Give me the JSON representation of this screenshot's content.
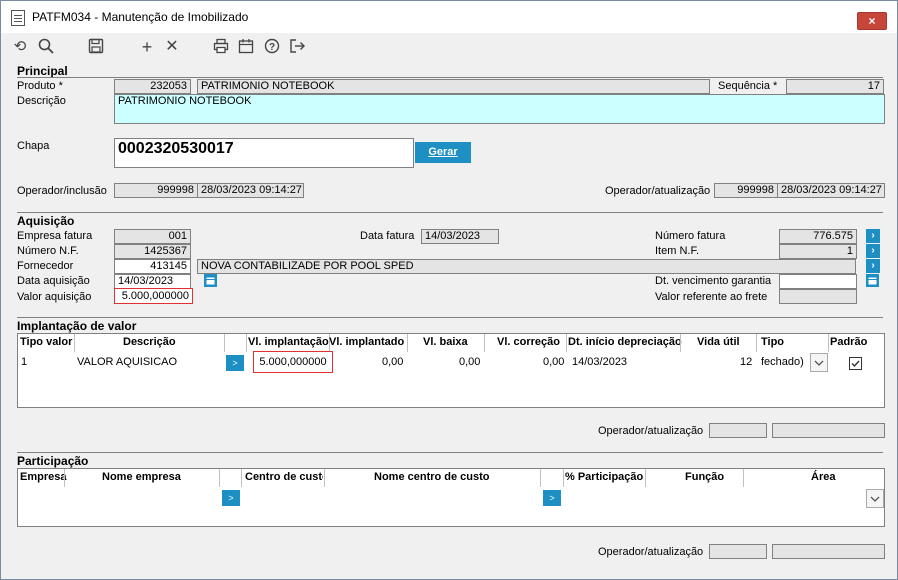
{
  "window": {
    "title": "PATFM034 - Manutenção de Imobilizado",
    "close_label": "×"
  },
  "toolbar": {
    "icons": [
      "undo-icon",
      "search-icon",
      "save-icon",
      "add-icon",
      "delete-icon",
      "print-icon",
      "calendar-icon",
      "help-icon",
      "exit-icon"
    ]
  },
  "principal": {
    "title": "Principal",
    "produto_label": "Produto *",
    "produto_code": "232053",
    "produto_name": "PATRIMONIO NOTEBOOK",
    "sequencia_label": "Sequência *",
    "sequencia_value": "17",
    "descricao_label": "Descrição",
    "descricao_value": "PATRIMONIO NOTEBOOK",
    "chapa_label": "Chapa",
    "chapa_value": "0002320530017",
    "gerar_label": "Gerar",
    "op_inclusao_label": "Operador/inclusão",
    "op_inclusao_user": "999998",
    "op_inclusao_date": "28/03/2023 09:14:27",
    "op_atualizacao_label": "Operador/atualização",
    "op_atualizacao_user": "999998",
    "op_atualizacao_date": "28/03/2023 09:14:27"
  },
  "aquisicao": {
    "title": "Aquisição",
    "empresa_fatura_label": "Empresa fatura",
    "empresa_fatura_value": "001",
    "data_fatura_label": "Data fatura",
    "data_fatura_value": "14/03/2023",
    "numero_fatura_label": "Número fatura",
    "numero_fatura_value": "776.575",
    "numero_nf_label": "Número N.F.",
    "numero_nf_value": "1425367",
    "item_nf_label": "Item N.F.",
    "item_nf_value": "1",
    "fornecedor_label": "Fornecedor",
    "fornecedor_code": "413145",
    "fornecedor_name": "NOVA CONTABILIZADE POR POOL SPED",
    "data_aquisicao_label": "Data aquisição",
    "data_aquisicao_value": "14/03/2023",
    "dt_venc_label": "Dt. vencimento garantia",
    "valor_aquisicao_label": "Valor aquisição",
    "valor_aquisicao_value": "5.000,000000",
    "valor_frete_label": "Valor referente ao frete"
  },
  "implantacao": {
    "title": "Implantação de valor",
    "headers": [
      "Tipo valor",
      "Descrição",
      "Vl. implantação",
      "Vl. implantado",
      "Vl. baixa",
      "Vl. correção",
      "Dt. início depreciação",
      "Vida útil",
      "Tipo",
      "Padrão"
    ],
    "row": {
      "tipo": "1",
      "descricao": "VALOR AQUISICAO",
      "vl_implantacao": "5.000,000000",
      "vl_implantado": "0,00",
      "vl_baixa": "0,00",
      "vl_correcao": "0,00",
      "dt_inicio": "14/03/2023",
      "vida_util": "12",
      "tipo_sel": "fechado)"
    },
    "op_label": "Operador/atualização"
  },
  "participacao": {
    "title": "Participação",
    "headers": [
      "Empresa",
      "Nome empresa",
      "Centro de custo",
      "Nome centro de custo",
      "% Participação",
      "Função",
      "Área"
    ],
    "op_label": "Operador/atualização"
  },
  "colors": {
    "accent": "#1e8fc3",
    "highlight": "#e03030",
    "description_bg": "#ccffff"
  }
}
